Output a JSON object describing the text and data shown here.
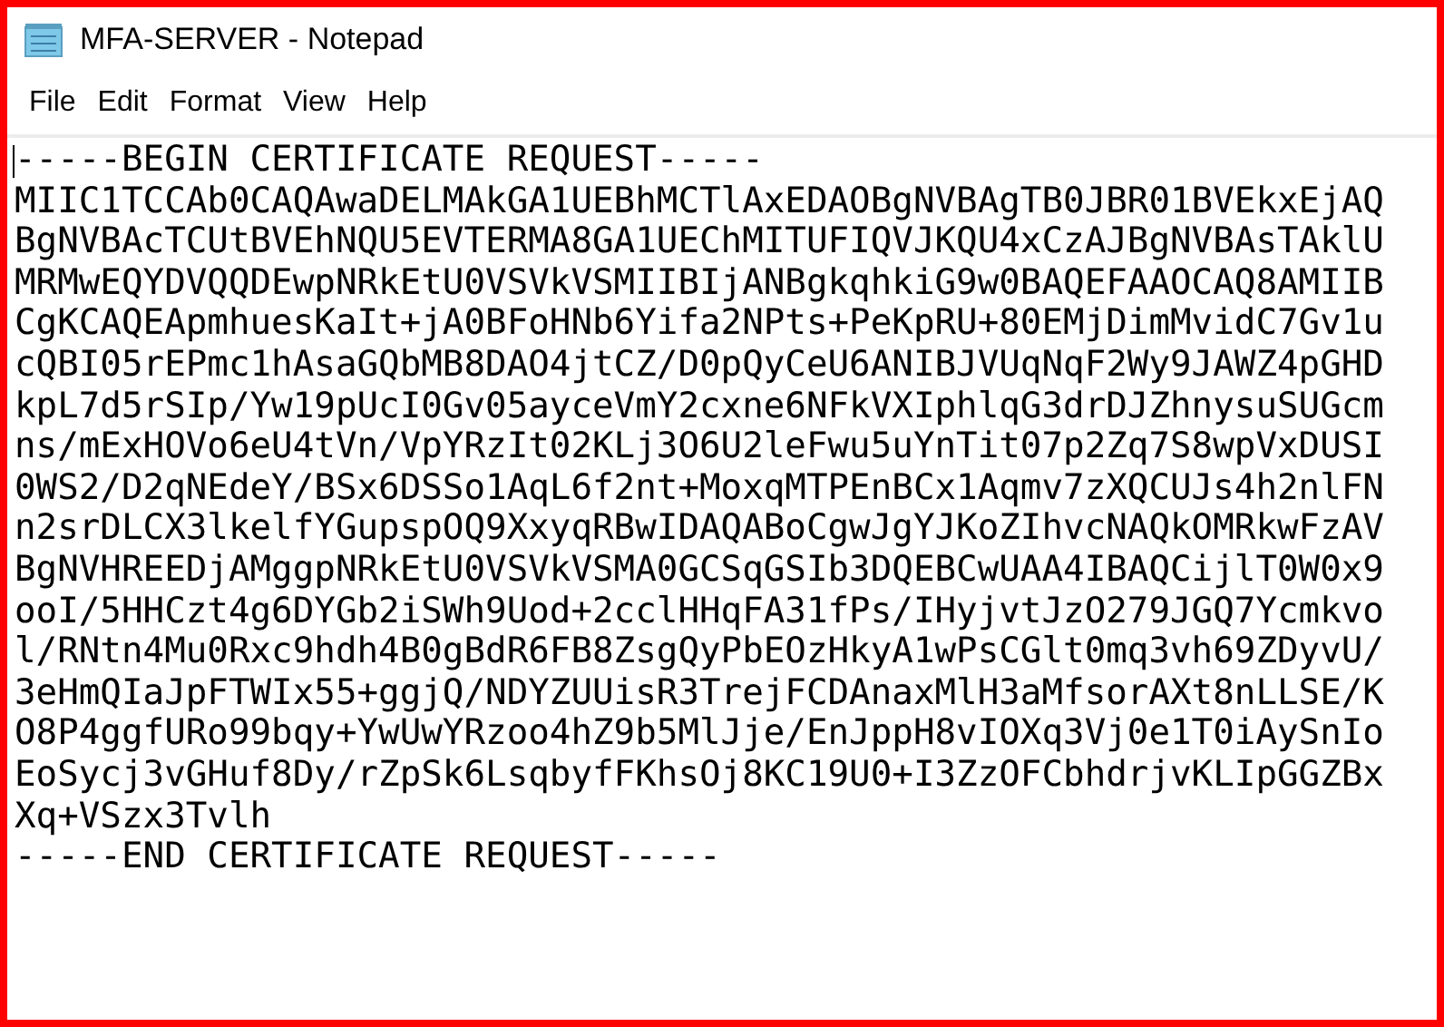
{
  "window": {
    "title": "MFA-SERVER - Notepad"
  },
  "menu": [
    "File",
    "Edit",
    "Format",
    "View",
    "Help"
  ],
  "editor": {
    "lines": [
      "-----BEGIN CERTIFICATE REQUEST-----",
      "MIIC1TCCAb0CAQAwaDELMAkGA1UEBhMCTlAxEDAOBgNVBAgTB0JBR01BVEkxEjAQ",
      "BgNVBAcTCUtBVEhNQU5EVTERMA8GA1UEChMITUFIQVJKQU4xCzAJBgNVBAsTAklU",
      "MRMwEQYDVQQDEwpNRkEtU0VSVkVSMIIBIjANBgkqhkiG9w0BAQEFAAOCAQ8AMIIB",
      "CgKCAQEApmhuesKaIt+jA0BFoHNb6Yifa2NPts+PeKpRU+80EMjDimMvidC7Gv1u",
      "cQBI05rEPmc1hAsaGQbMB8DAO4jtCZ/D0pQyCeU6ANIBJVUqNqF2Wy9JAWZ4pGHD",
      "kpL7d5rSIp/Yw19pUcI0Gv05ayceVmY2cxne6NFkVXIphlqG3drDJZhnysuSUGcm",
      "ns/mExHOVo6eU4tVn/VpYRzIt02KLj3O6U2leFwu5uYnTit07p2Zq7S8wpVxDUSI",
      "0WS2/D2qNEdeY/BSx6DSSo1AqL6f2nt+MoxqMTPEnBCx1Aqmv7zXQCUJs4h2nlFN",
      "n2srDLCX3lkelfYGupspOQ9XxyqRBwIDAQABoCgwJgYJKoZIhvcNAQkOMRkwFzAV",
      "BgNVHREEDjAMggpNRkEtU0VSVkVSMA0GCSqGSIb3DQEBCwUAA4IBAQCijlT0W0x9",
      "ooI/5HHCzt4g6DYGb2iSWh9Uod+2cclHHqFA31fPs/IHyjvtJzO279JGQ7Ycmkvo",
      "l/RNtn4Mu0Rxc9hdh4B0gBdR6FB8ZsgQyPbEOzHkyA1wPsCGlt0mq3vh69ZDyvU/",
      "3eHmQIaJpFTWIx55+ggjQ/NDYZUUisR3TrejFCDAnaxMlH3aMfsorAXt8nLLSE/K",
      "O8P4ggfURo99bqy+YwUwYRzoo4hZ9b5MlJje/EnJppH8vIOXq3Vj0e1T0iAySnIo",
      "EoSycj3vGHuf8Dy/rZpSk6LsqbyfFKhsOj8KC19U0+I3ZzOFCbhdrjvKLIpGGZBx",
      "Xq+VSzx3Tvlh",
      "-----END CERTIFICATE REQUEST-----"
    ]
  }
}
